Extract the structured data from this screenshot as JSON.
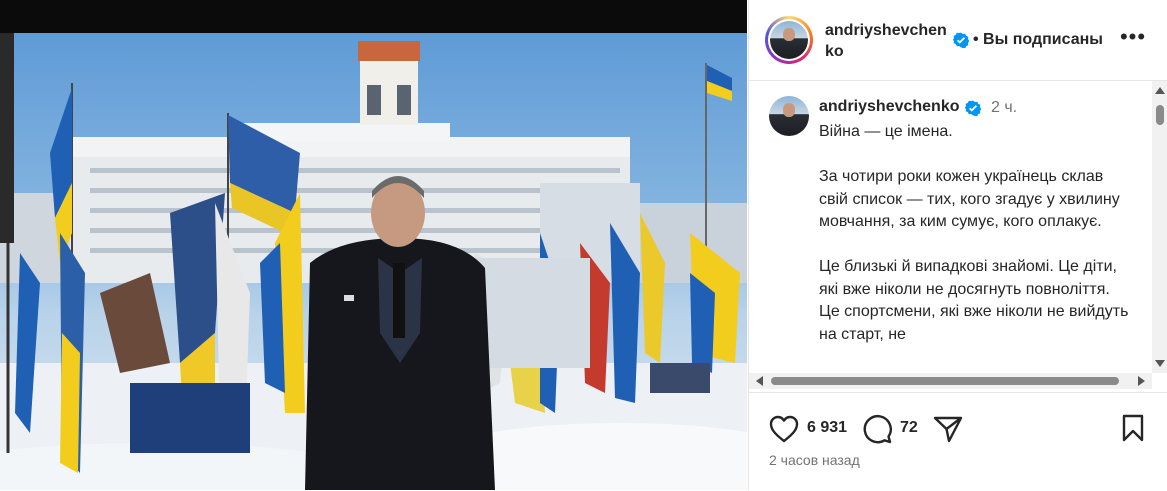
{
  "post": {
    "author": {
      "username_line1": "andriyshevchen",
      "username_line2": "ko",
      "username": "andriyshevchenko",
      "verified_icon": "verified-badge-icon",
      "follow_status": "• Вы подписаны"
    },
    "more_label": "•••",
    "caption": {
      "time": "2 ч.",
      "paragraphs": [
        "Війна — це імена.",
        "За чотири роки кожен українець склав свій список — тих, кого згадує у хвилину мовчання, за ким сумує, кого оплакує.",
        "Це близькі й випадкові знайомі. Це діти, які вже ніколи не досягнуть повноліття. Це спортсмени, які вже ніколи не вийдуть на старт, не"
      ]
    },
    "actions": {
      "likes": "6 931",
      "comments": "72",
      "like_icon": "heart-icon",
      "comment_icon": "comment-icon",
      "share_icon": "share-icon",
      "save_icon": "bookmark-icon"
    },
    "posted_ago": "2 часов назад"
  },
  "colors": {
    "verified": "#0095f6",
    "text": "#262626",
    "secondary": "#737373",
    "flag_blue": "#1f5fb4",
    "flag_yellow": "#f2cd1d"
  }
}
